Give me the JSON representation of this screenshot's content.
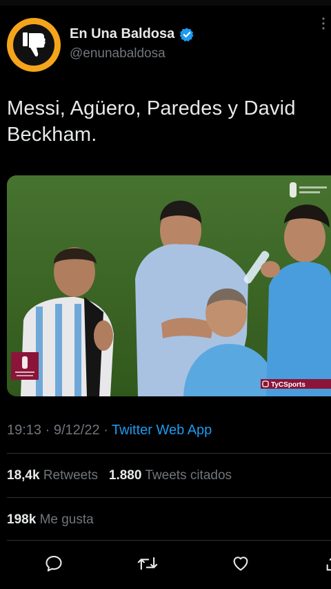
{
  "author": {
    "name": "En Una Baldosa",
    "handle": "@enunabaldosa",
    "verified": true,
    "avatar_icon": "thumbs-down-icon",
    "avatar_colors": {
      "ring": "#f5a51b",
      "center": "#111111"
    }
  },
  "tweet": {
    "text": "Messi, Agüero, Paredes y David Beckham.",
    "media": {
      "alt_icon": "photo-icon",
      "overlays": {
        "broadcaster": "TyCSports"
      }
    },
    "time": "19:13",
    "date": "9/12/22",
    "separator": "·",
    "source": "Twitter Web App"
  },
  "stats": {
    "retweets_count": "18,4k",
    "retweets_label": "Retweets",
    "quotes_count": "1.880",
    "quotes_label": "Tweets citados",
    "likes_count": "198k",
    "likes_label": "Me gusta"
  },
  "actions": [
    {
      "name": "reply-button",
      "icon": "comment-icon"
    },
    {
      "name": "retweet-button",
      "icon": "retweet-icon"
    },
    {
      "name": "like-button",
      "icon": "heart-icon"
    },
    {
      "name": "share-button",
      "icon": "share-icon"
    }
  ],
  "colors": {
    "background": "#000000",
    "text": "#e7e9ea",
    "secondary": "#71767b",
    "accent": "#1d9bf0",
    "divider": "#2f3336"
  }
}
